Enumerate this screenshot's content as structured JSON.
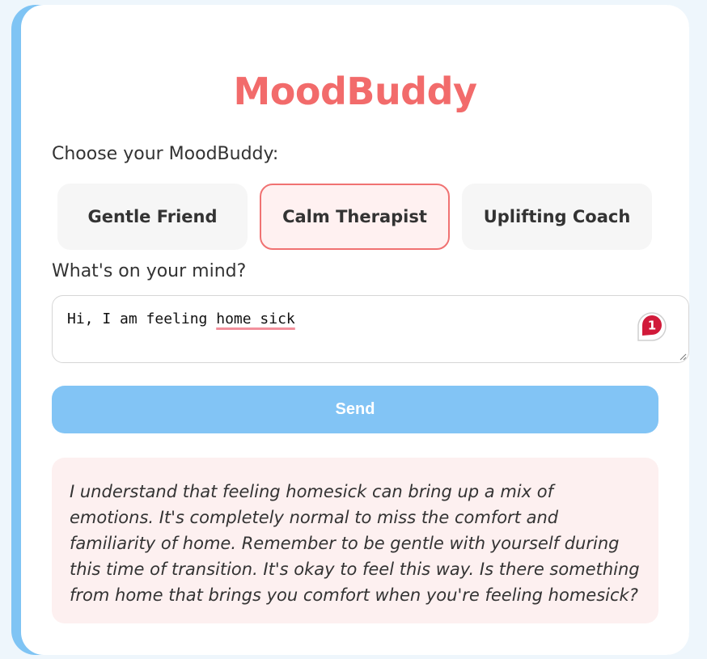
{
  "app": {
    "title": "MoodBuddy"
  },
  "personas": {
    "label": "Choose your MoodBuddy:",
    "items": [
      {
        "label": "Gentle Friend",
        "selected": false
      },
      {
        "label": "Calm Therapist",
        "selected": true
      },
      {
        "label": "Uplifting Coach",
        "selected": false
      }
    ]
  },
  "input": {
    "label": "What's on your mind?",
    "value_plain": "Hi, I am feeling ",
    "value_flagged": "home sick",
    "spellcheck_count": "1"
  },
  "send": {
    "label": "Send"
  },
  "response": {
    "text": "I understand that feeling homesick can bring up a mix of emotions. It's completely normal to miss the comfort and familiarity of home. Remember to be gentle with yourself during this time of transition. It's okay to feel this way. Is there something from home that brings you comfort when you're feeling homesick?"
  },
  "colors": {
    "accent": "#f26b6b",
    "button": "#82c4f5",
    "selected_bg": "#fff1f1",
    "response_bg": "#fdf0f0",
    "badge": "#d11a3a"
  }
}
